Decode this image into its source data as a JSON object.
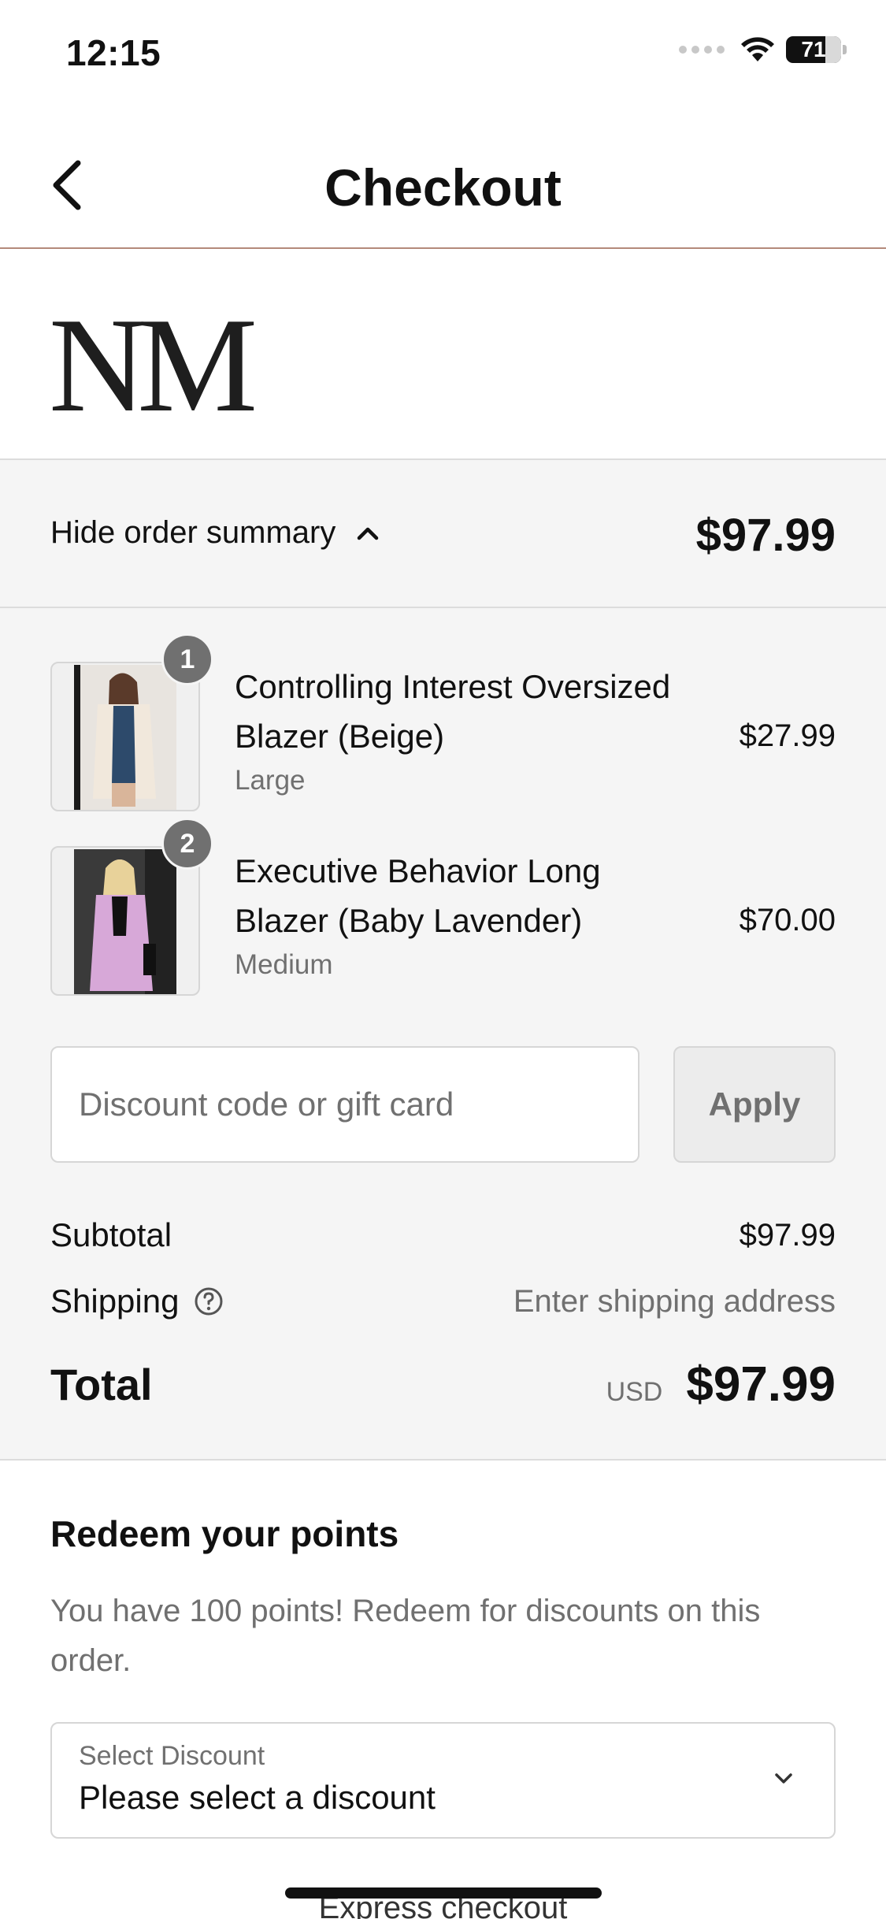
{
  "status_bar": {
    "time": "12:15",
    "battery": "71"
  },
  "header": {
    "title": "Checkout",
    "back_icon": "chevron-left-icon"
  },
  "brand": {
    "logo": "NM"
  },
  "order_summary": {
    "toggle_label": "Hide order summary",
    "total": "$97.99",
    "items": [
      {
        "quantity": "1",
        "name_line1": "Controlling Interest Oversized",
        "name_line2": "Blazer (Beige)",
        "variant": "Large",
        "price": "$27.99"
      },
      {
        "quantity": "2",
        "name_line1": "Executive Behavior Long",
        "name_line2": "Blazer (Baby Lavender)",
        "variant": "Medium",
        "price": "$70.00"
      }
    ],
    "discount": {
      "placeholder": "Discount code or gift card",
      "apply_label": "Apply"
    },
    "subtotal_label": "Subtotal",
    "subtotal_value": "$97.99",
    "shipping_label": "Shipping",
    "shipping_value": "Enter shipping address",
    "total_label": "Total",
    "currency": "USD",
    "total_value": "$97.99"
  },
  "redeem": {
    "title": "Redeem your points",
    "description": "You have 100 points! Redeem for discounts on this order.",
    "select_label": "Select Discount",
    "select_value": "Please select a discount"
  },
  "footer": {
    "express_checkout": "Express checkout"
  },
  "colors": {
    "summary_bg": "#f5f5f5",
    "header_divider": "#b48a7a",
    "muted_text": "#707070",
    "badge": "#707070"
  }
}
